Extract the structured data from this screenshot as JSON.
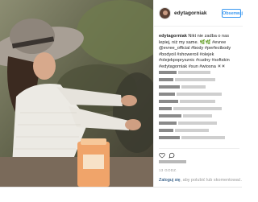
{
  "post": {
    "username": "edytagorniak",
    "follow_label": "Obserwuj",
    "caption_user": "edytagorniak",
    "caption_text": "Nikt nie zadba o nas lepiej, niż my same. 🌿🌿 #evree @evree_official #body #perfectbody #bodyoil #showeroil #olejek #olejekpoprysznic #cudny #softskin #edytagorniak #sun #wiosna ☀☀",
    "date": "13 GODZ.",
    "login_link": "Zaloguj się",
    "login_text": ", aby polubić lub skomentować."
  },
  "icons": {
    "like": "heart-icon",
    "comment": "comment-icon",
    "more": "more-options-icon"
  },
  "colors": {
    "accent": "#3897f0",
    "text": "#262626",
    "muted": "#999999"
  }
}
